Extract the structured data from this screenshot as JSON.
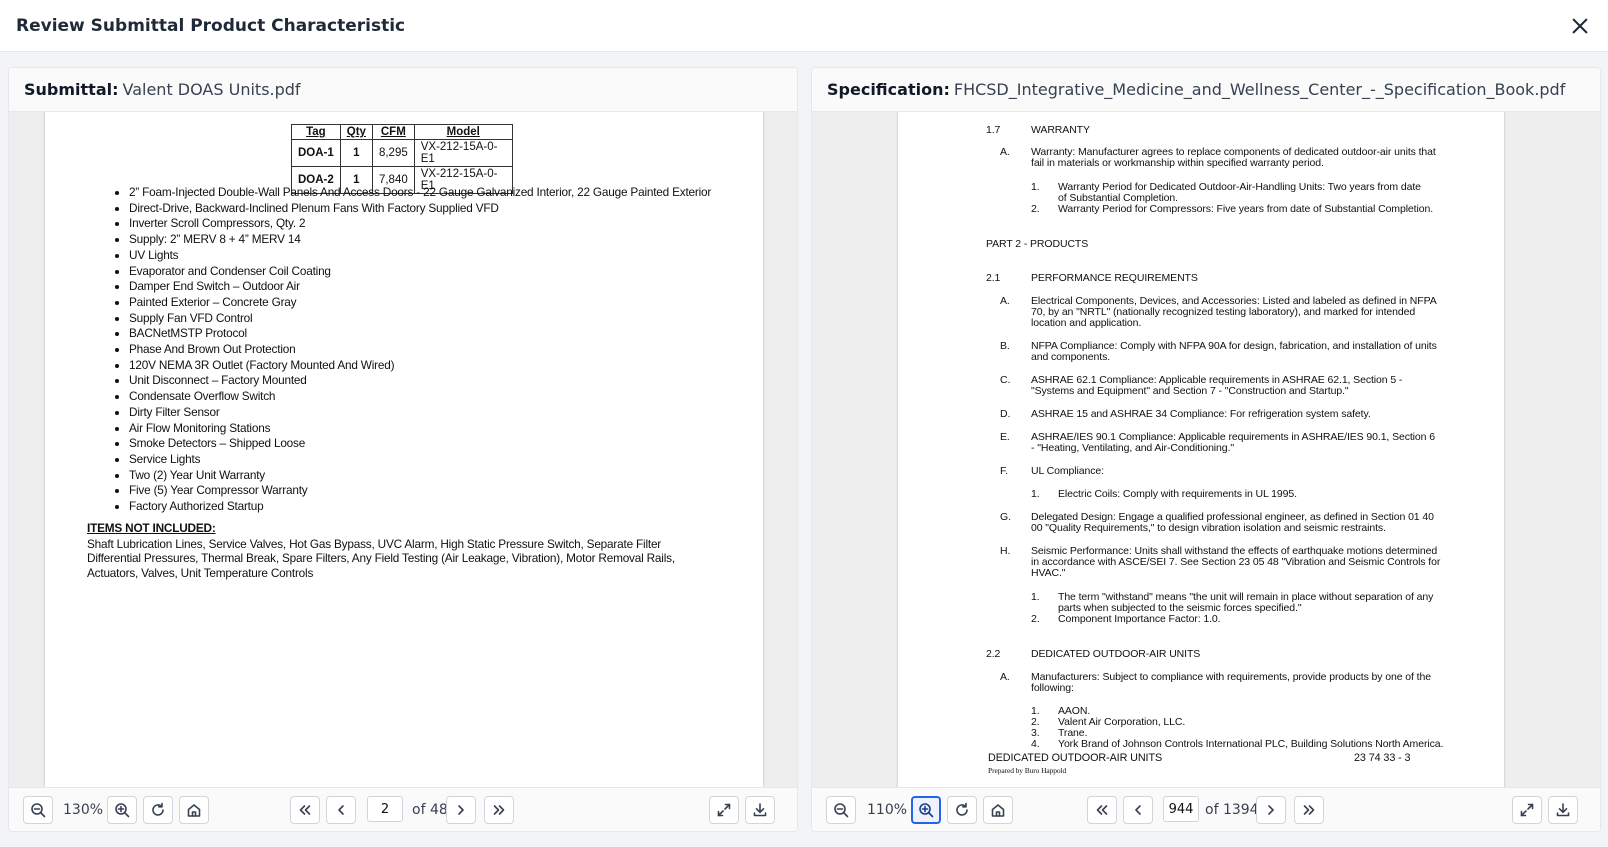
{
  "dialog": {
    "title": "Review Submittal Product Characteristic"
  },
  "left": {
    "label": "Submittal:",
    "filename": "Valent DOAS Units.pdf",
    "zoom": "130%",
    "page": "2",
    "of_total": "of 48",
    "table": {
      "headers": [
        "Tag",
        "Qty",
        "CFM",
        "Model"
      ],
      "rows": [
        [
          "DOA-1",
          "1",
          "8,295",
          "VX-212-15A-0-E1"
        ],
        [
          "DOA-2",
          "1",
          "7,840",
          "VX-212-15A-0-E1"
        ]
      ]
    },
    "bullets": [
      "2” Foam-Injected Double-Wall Panels And Access Doors - 22 Gauge Galvanized Interior, 22 Gauge Painted Exterior",
      "Direct-Drive, Backward-Inclined Plenum Fans With Factory Supplied VFD",
      "Inverter Scroll Compressors, Qty. 2",
      "Supply: 2” MERV 8 + 4” MERV 14",
      "UV Lights",
      "Evaporator and Condenser Coil Coating",
      "Damper End Switch – Outdoor Air",
      "Painted Exterior – Concrete Gray",
      "Supply Fan VFD Control",
      "BACNetMSTP Protocol",
      "Phase And Brown Out Protection",
      "120V NEMA 3R Outlet (Factory Mounted And Wired)",
      "Unit Disconnect – Factory Mounted",
      "Condensate Overflow Switch",
      "Dirty Filter Sensor",
      "Air Flow Monitoring Stations",
      "Smoke Detectors – Shipped Loose",
      "Service Lights",
      "Two (2) Year Unit Warranty",
      "Five (5) Year Compressor Warranty",
      "Factory Authorized Startup"
    ],
    "not_included_heading": "ITEMS NOT INCLUDED:",
    "not_included_text": "Shaft Lubrication Lines, Service Valves, Hot Gas Bypass, UVC Alarm, High Static Pressure Switch, Separate Filter Differential Pressures, Thermal Break, Spare Filters, Any Field Testing (Air Leakage, Vibration), Motor Removal Rails, Actuators, Valves, Unit Temperature Controls"
  },
  "right": {
    "label": "Specification:",
    "filename": "FHCSD_Integrative_Medicine_and_Wellness_Center_-_Specification_Book.pdf",
    "zoom": "110%",
    "page": "944",
    "of_total": "of 1394",
    "spec": {
      "s17_num": "1.7",
      "s17_title": "WARRANTY",
      "s17_A_letter": "A.",
      "s17_A": "Warranty: Manufacturer agrees to replace components of dedicated outdoor-air units that fail in materials or workmanship within specified warranty period.",
      "s17_A1_num": "1.",
      "s17_A1": "Warranty Period for Dedicated Outdoor-Air-Handling Units: Two years from date of Substantial Completion.",
      "s17_A2_num": "2.",
      "s17_A2": "Warranty Period for Compressors: Five years from date of Substantial Completion.",
      "part2": "PART 2 - PRODUCTS",
      "s21_num": "2.1",
      "s21_title": "PERFORMANCE REQUIREMENTS",
      "A_letter": "A.",
      "A": "Electrical Components, Devices, and Accessories: Listed and labeled as defined in NFPA 70, by an \"NRTL\" (nationally recognized testing laboratory), and marked for intended location and application.",
      "B_letter": "B.",
      "B": "NFPA Compliance: Comply with NFPA 90A for design, fabrication, and installation of units and components.",
      "C_letter": "C.",
      "C": "ASHRAE 62.1 Compliance: Applicable requirements in ASHRAE 62.1, Section 5 - \"Systems and Equipment\" and Section 7 - \"Construction and Startup.\"",
      "D_letter": "D.",
      "D": "ASHRAE 15 and ASHRAE 34 Compliance: For refrigeration system safety.",
      "E_letter": "E.",
      "E": "ASHRAE/IES 90.1 Compliance: Applicable requirements in ASHRAE/IES 90.1, Section 6 - \"Heating, Ventilating, and Air-Conditioning.\"",
      "F_letter": "F.",
      "F": "UL Compliance:",
      "F1_num": "1.",
      "F1": "Electric Coils: Comply with requirements in UL 1995.",
      "G_letter": "G.",
      "G": "Delegated Design: Engage a qualified professional engineer, as defined in Section 01 40 00 \"Quality Requirements,\" to design vibration isolation and seismic restraints.",
      "H_letter": "H.",
      "H": "Seismic Performance: Units shall withstand the effects of earthquake motions determined in accordance with ASCE/SEI 7. See Section 23 05 48 \"Vibration and Seismic Controls for HVAC.\"",
      "H1_num": "1.",
      "H1": "The term \"withstand\" means \"the unit will remain in place without separation of any parts when subjected to the seismic forces specified.\"",
      "H2_num": "2.",
      "H2": "Component Importance Factor: 1.0.",
      "s22_num": "2.2",
      "s22_title": "DEDICATED OUTDOOR-AIR UNITS",
      "s22_A_letter": "A.",
      "s22_A": "Manufacturers: Subject to compliance with requirements,  provide products by one of the following:",
      "m1_num": "1.",
      "m1": "AAON.",
      "m2_num": "2.",
      "m2": "Valent Air Corporation, LLC.",
      "m3_num": "3.",
      "m3": "Trane.",
      "m4_num": "4.",
      "m4": "York Brand of Johnson Controls International PLC, Building Solutions North America.",
      "footer_left": "DEDICATED OUTDOOR-AIR UNITS",
      "footer_right": "23 74 33 - 3",
      "prepared_by": "Prepared by Buro Happold"
    }
  },
  "icons": {
    "close": "close-icon",
    "zoom_out": "zoom-out-icon",
    "zoom_in": "zoom-in-icon",
    "rotate": "rotate-icon",
    "home": "home-icon",
    "first": "first-page-icon",
    "prev": "prev-page-icon",
    "next": "next-page-icon",
    "last": "last-page-icon",
    "expand": "expand-icon",
    "download": "download-icon"
  },
  "colors": {
    "active_border": "#2563eb",
    "background": "#f3f4f6"
  }
}
